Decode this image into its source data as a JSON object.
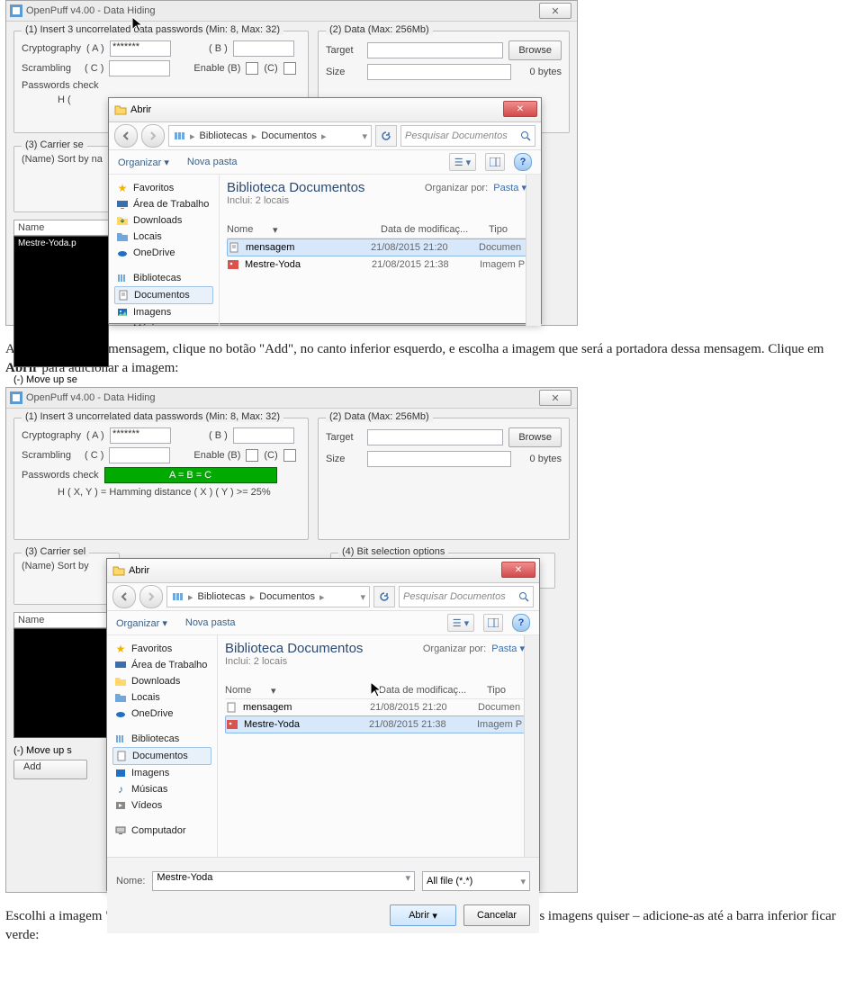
{
  "op": {
    "title": "OpenPuff v4.00 - Data Hiding",
    "close": "✕",
    "g1": {
      "legend": "(1) Insert 3 uncorrelated data passwords (Min: 8, Max: 32)",
      "crypt": "Cryptography",
      "a": "( A )",
      "aval": "*******",
      "b": "( B )",
      "scr": "Scrambling",
      "c": "( C )",
      "enb": "Enable (B)",
      "enc": "(C)",
      "pchk": "Passwords check",
      "passbar": "A = B = C",
      "hxy": "H ( X, Y )  =  Hamming distance ( X ) ( Y )  >=  25%",
      "hshort": "H ("
    },
    "g2": {
      "legend": "(2) Data (Max: 256Mb)",
      "target": "Target",
      "browse": "Browse",
      "size": "Size",
      "bytes": "0 bytes"
    },
    "g3": {
      "legend": "(3) Carrier se",
      "legend_full": "(3) Carrier sel",
      "sort": "(Name) Sort by na",
      "sort2": "(Name) Sort by",
      "name": "Name",
      "item": "Mestre-Yoda.p"
    },
    "g4": {
      "legend": "(4) Bit selection options"
    },
    "move1": "(-) Move up se",
    "move2": "(-) Move up s",
    "add": "Add"
  },
  "abrir": {
    "title": "Abrir",
    "crumb": {
      "lib": "Bibliotecas",
      "doc": "Documentos"
    },
    "search_ph": "Pesquisar Documentos",
    "org": "Organizar",
    "nova": "Nova pasta",
    "nav": {
      "fav": "Favoritos",
      "desk": "Área de Trabalho",
      "down": "Downloads",
      "loc": "Locais",
      "one": "OneDrive",
      "bib": "Bibliotecas",
      "doc": "Documentos",
      "img": "Imagens",
      "mus": "Músicas",
      "vid": "Vídeos",
      "comp": "Computador"
    },
    "lib_title": "Biblioteca Documentos",
    "lib_sub": "Inclui: 2 locais",
    "org_by": "Organizar por:",
    "org_val": "Pasta ▾",
    "cols": {
      "name": "Nome",
      "date": "Data de modificaç...",
      "type": "Tipo"
    },
    "files": [
      {
        "name": "mensagem",
        "date": "21/08/2015 21:20",
        "type": "Documen"
      },
      {
        "name": "Mestre-Yoda",
        "date": "21/08/2015 21:38",
        "type": "Imagem P"
      }
    ],
    "footer": {
      "nome": "Nome:",
      "val": "Mestre-Yoda",
      "filter": "All file (*.*)",
      "open": "Abrir",
      "cancel": "Cancelar"
    }
  },
  "text": {
    "p1a": "Após entrar com a mensagem, clique no botão \"Add\", no canto inferior esquerdo, e escolha a imagem que será a portadora dessa mensagem. Clique em ",
    "p1b": "Abrir",
    "p1c": " para adicionar a imagem:",
    "p2": "Escolhi a imagem \"Mestre-Yoda.png\" que estava em meu computador. Você pode adicionar quantas imagens quiser – adicione-as até a barra inferior ficar verde:"
  }
}
